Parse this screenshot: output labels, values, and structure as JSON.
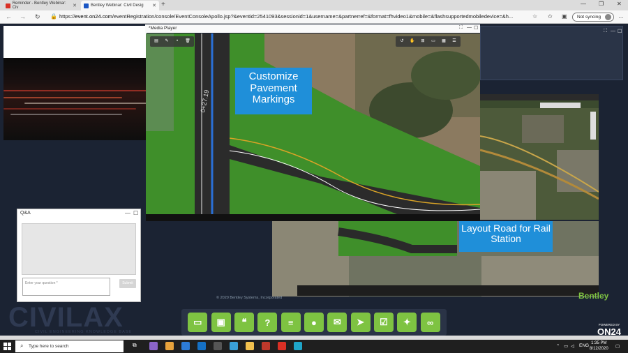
{
  "browser": {
    "tabs": [
      {
        "title": "Reminder - Bentley Webinar: Civ",
        "color": "#d93025"
      },
      {
        "title": "Bentley Webinar: Civil Desig",
        "color": "#1a56c4"
      }
    ],
    "url_prefix": "https://",
    "url_host": "event.on24.com",
    "url_path": "/eventRegistration/console/EventConsoleApollo.jsp?&eventid=2541093&sessionid=1&username=&partnerref=&format=fhvideo1&mobile=&flashsupportedmobiledevice=&h...",
    "sync_label": "Not syncing"
  },
  "media_player": {
    "title": "*Media Player",
    "callout_top": "Customize Pavement Markings",
    "road_label": "0+27.19"
  },
  "secondary": {
    "callout": "Layout Road for Rail Station"
  },
  "qa": {
    "title": "Q&A",
    "placeholder": "Enter your question *",
    "submit_label": "Submit"
  },
  "footer": {
    "copyright": "© 2020 Bentley Systems, Incorporated",
    "brand": "Bentley"
  },
  "logo": {
    "name": "CIVILAX",
    "tagline": "CIVIL ENGINEERING KNOWLEDGE BASE"
  },
  "on24": {
    "powered": "POWERED BY",
    "name": "ON24"
  },
  "engagement_icons": [
    "slides-icon",
    "media-icon",
    "chat-icon",
    "help-icon",
    "resources-icon",
    "speaker-icon",
    "email-icon",
    "share-icon",
    "survey-icon",
    "twitter-icon",
    "link-icon"
  ],
  "taskbar": {
    "search_placeholder": "Type here to search",
    "time": "1:35 PM",
    "date": "8/12/2020",
    "lang": "ENG"
  },
  "colors": {
    "accent_green": "#7ec342",
    "callout_blue": "#1f8fd9",
    "bg": "#1b2333"
  }
}
